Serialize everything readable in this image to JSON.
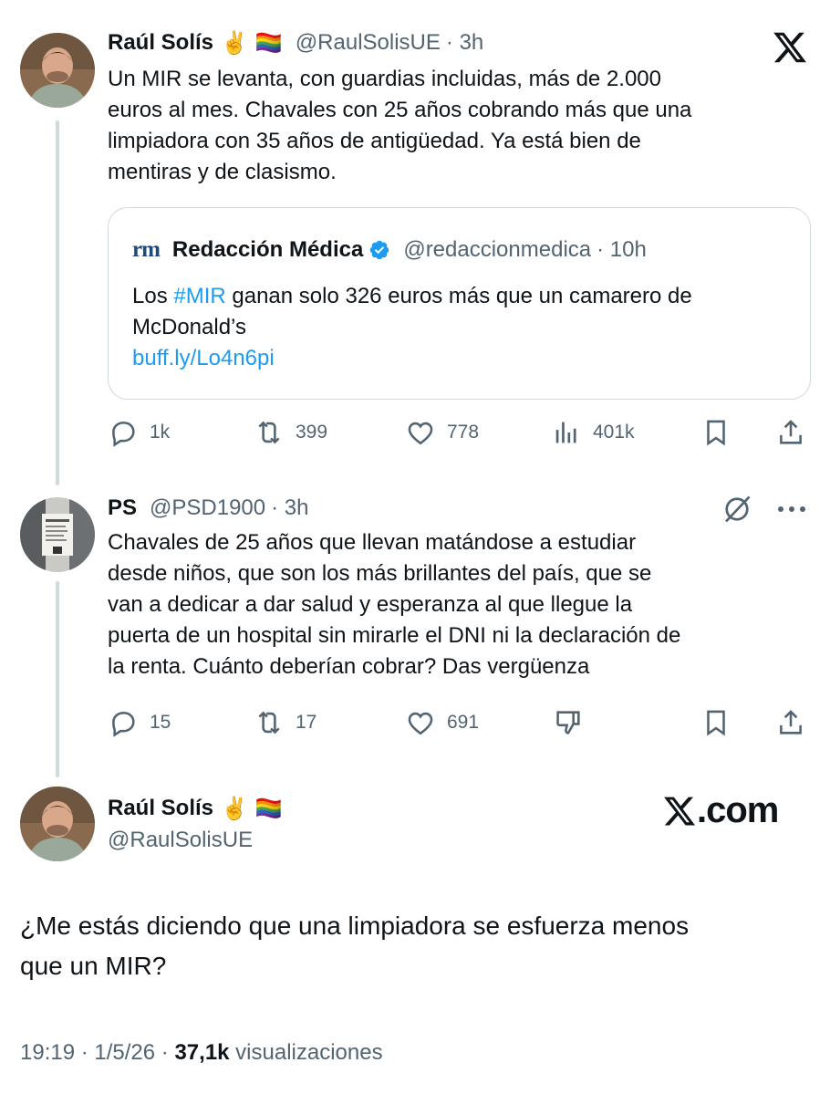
{
  "tweet1": {
    "name": "Raúl Solís",
    "emoji_1": "✌️",
    "emoji_2": "🏳️‍🌈",
    "handle": "@RaulSolisUE",
    "time": "· 3h",
    "lines": [
      "Un MIR se levanta, con guardias incluidas, más de 2.000",
      "euros al mes. Chavales con 25 años cobrando más que una",
      "limpiadora con 35 años de antigüedad. Ya está bien de",
      "mentiras y de clasismo."
    ],
    "quote": {
      "logo": "rm",
      "name": "Redacción Médica",
      "handle": "@redaccionmedica",
      "time": "· 10h",
      "line1_pre": "Los ",
      "hashtag": "#MIR",
      "line1_post": " ganan solo 326 euros más que un camarero de",
      "line2": "McDonald’s",
      "link": "buff.ly/Lo4n6pi"
    },
    "actions": {
      "replies": "1k",
      "reposts": "399",
      "likes": "778",
      "views": "401k"
    }
  },
  "tweet2": {
    "name": "PS",
    "handle": "@PSD1900",
    "time": "· 3h",
    "lines": [
      "Chavales de 25 años que llevan matándose a estudiar",
      "desde niños, que son los más brillantes del país, que se",
      "van a dedicar a dar salud y esperanza al que llegue la",
      "puerta de un hospital sin mirarle el DNI ni la declaración de",
      "la renta. Cuánto deberían cobrar? Das vergüenza"
    ],
    "actions": {
      "replies": "15",
      "reposts": "17",
      "likes": "691"
    }
  },
  "main": {
    "name": "Raúl Solís",
    "emoji_1": "✌️",
    "emoji_2": "🏳️‍🌈",
    "handle": "@RaulSolisUE",
    "brand": ".com",
    "lines": [
      "¿Me estás diciendo que una limpiadora se esfuerza menos",
      "que un MIR?"
    ],
    "footer": {
      "time": "19:19 · 1/5/26 · ",
      "views_count": "37,1k",
      "views_label": " visualizaciones"
    }
  },
  "colors": {
    "text": "#0f1419",
    "secondary": "#536471",
    "link": "#1d9bf0",
    "border": "#cfd9de"
  },
  "icons": [
    "reply-icon",
    "repost-icon",
    "like-icon",
    "views-icon",
    "bookmark-icon",
    "share-icon",
    "x-logo-icon",
    "grok-icon",
    "more-icon",
    "dislike-icon",
    "verified-badge-icon"
  ]
}
